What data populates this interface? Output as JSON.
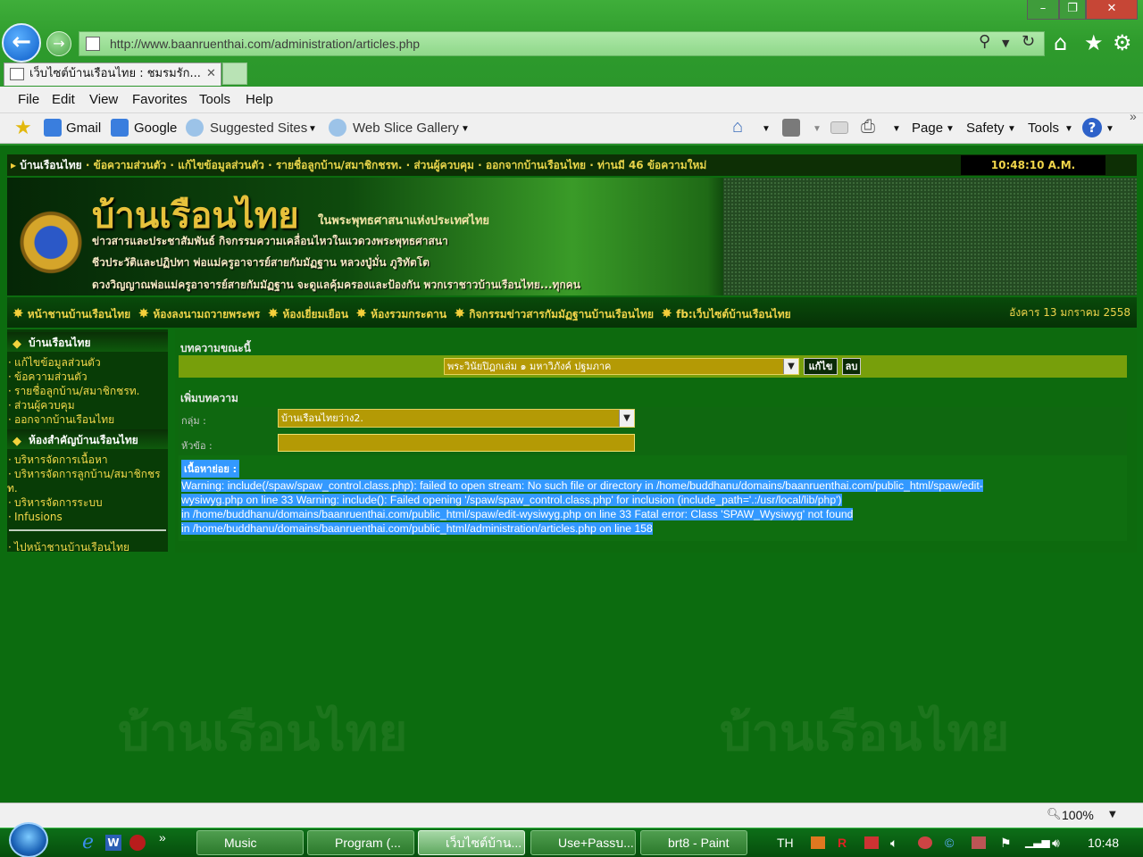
{
  "browser": {
    "address_url": "http://www.baanruenthai.com/administration/articles.php",
    "tab_title": "เว็บไซต์บ้านเรือนไทย : ชมรมรัก...",
    "menu": [
      "File",
      "Edit",
      "View",
      "Favorites",
      "Tools",
      "Help"
    ],
    "favorites_bar": [
      "Gmail",
      "Google",
      "Suggested Sites",
      "Web Slice Gallery"
    ],
    "command_bar": [
      "Page",
      "Safety",
      "Tools"
    ],
    "zoom": "100%"
  },
  "site": {
    "top_links": [
      "บ้านเรือนไทย",
      "ข้อความส่วนตัว",
      "แก้ไขข้อมูลส่วนตัว",
      "รายชื่อลูกบ้าน/สมาชิกชรท.",
      "ส่วนผู้ควบคุม",
      "ออกจากบ้านเรือนไทย",
      "ท่านมี 46 ข้อความใหม่"
    ],
    "clock": "10:48:10 A.M.",
    "banner_title": "บ้านเรือนไทย",
    "banner_subtitle": "ในพระพุทธศาสนาแห่งประเทศไทย",
    "banner_lines": [
      "ข่าวสารและประชาสัมพันธ์ กิจกรรมความเคลื่อนไหวในแวดวงพระพุทธศาสนา",
      "ชีวประวัติและปฏิปทา พ่อแม่ครูอาจารย์สายกัมมัฏฐาน หลวงปู่มั่น ภูริทัตโต",
      "ดวงวิญญาณพ่อแม่ครูอาจารย์สายกัมมัฏฐาน จะดูแลคุ้มครองและป้องกัน พวกเราชาวบ้านเรือนไทย...ทุกคน"
    ],
    "nav_items": [
      "หน้าชานบ้านเรือนไทย",
      "ห้องลงนามถวายพระพร",
      "ห้องเยี่ยมเยือน",
      "ห้องรวมกระดาน",
      "กิจกรรมข่าวสารกัมมัฏฐานบ้านเรือนไทย",
      "fb:เว็บไซต์บ้านเรือนไทย"
    ],
    "date": "อังคาร 13 มกราคม 2558",
    "watermark": "บ้านเรือนไทย"
  },
  "sidebar": {
    "section1_title": "บ้านเรือนไทย",
    "section1_links": [
      "แก้ไขข้อมูลส่วนตัว",
      "ข้อความส่วนตัว",
      "รายชื่อลูกบ้าน/สมาชิกชรท.",
      "ส่วนผู้ควบคุม",
      "ออกจากบ้านเรือนไทย"
    ],
    "section2_title": "ห้องสำคัญบ้านเรือนไทย",
    "section2_links": [
      "บริหารจัดการเนื้อหา",
      "บริหารจัดการลูกบ้าน/สมาชิกชร",
      "ท.",
      "บริหารจัดการระบบ",
      "Infusions"
    ],
    "bottom_link": "ไปหน้าชานบ้านเรือนไทย"
  },
  "main": {
    "current_label": "บทความขณะนี้",
    "current_select": "พระวินัยปิฎกเล่ม ๑ มหาวิภังค์ ปฐมภาค",
    "edit_button": "แก้ไข",
    "delete_button": "ลบ",
    "add_label": "เพิ่มบทความ",
    "group_label": "กลุ่ม :",
    "group_value": "บ้านเรือนไทยว่าง2.",
    "title_label": "หัวข้อ :",
    "title_value": "",
    "summary_label": "เนื้อหาย่อย :",
    "error_lines": [
      "Warning: include(/spaw/spaw_control.class.php): failed to open stream: No such file or directory in /home/buddhanu/domains/baanruenthai.com/public_html/spaw/edit-",
      "wysiwyg.php on line 33 Warning: include(): Failed opening '/spaw/spaw_control.class.php' for inclusion (include_path='.:/usr/local/lib/php')",
      "in /home/buddhanu/domains/baanruenthai.com/public_html/spaw/edit-wysiwyg.php on line 33 Fatal error: Class 'SPAW_Wysiwyg' not found",
      "in /home/buddhanu/domains/baanruenthai.com/public_html/administration/articles.php on line 158"
    ]
  },
  "taskbar": {
    "buttons": [
      "Music",
      "Program (...",
      "เว็บไซต์บ้าน...",
      "Use+Passบ...",
      "brt8 - Paint"
    ],
    "lang": "TH",
    "time": "10:48"
  },
  "colors": {
    "page_bg": "#0c6c0f",
    "nav_text": "#f1d44a",
    "selection": "#3399ff"
  }
}
